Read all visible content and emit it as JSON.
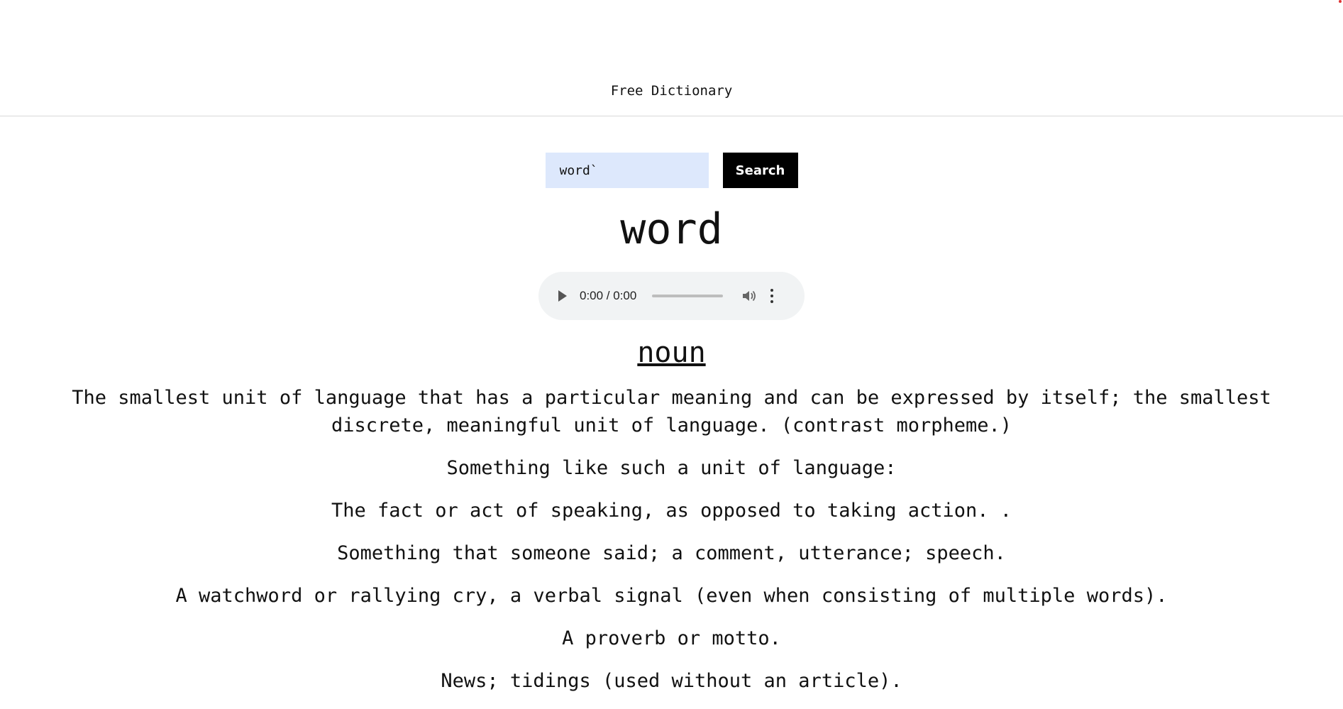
{
  "header": {
    "title": "Free Dictionary"
  },
  "search": {
    "value": "word`",
    "button_label": "Search"
  },
  "entry": {
    "word": "word",
    "audio": {
      "time": "0:00 / 0:00"
    },
    "part_of_speech": "noun",
    "definitions": [
      "The smallest unit of language that has a particular meaning and can be expressed by itself; the smallest discrete, meaningful unit of language. (contrast morpheme.)",
      "Something like such a unit of language:",
      "The fact or act of speaking, as opposed to taking action. .",
      "Something that someone said; a comment, utterance; speech.",
      "A watchword or rallying cry, a verbal signal (even when consisting of multiple words).",
      "A proverb or motto.",
      "News; tidings (used without an article)."
    ]
  },
  "icons": {
    "play": "play-icon",
    "volume": "volume-icon",
    "more": "more-vert-icon"
  }
}
